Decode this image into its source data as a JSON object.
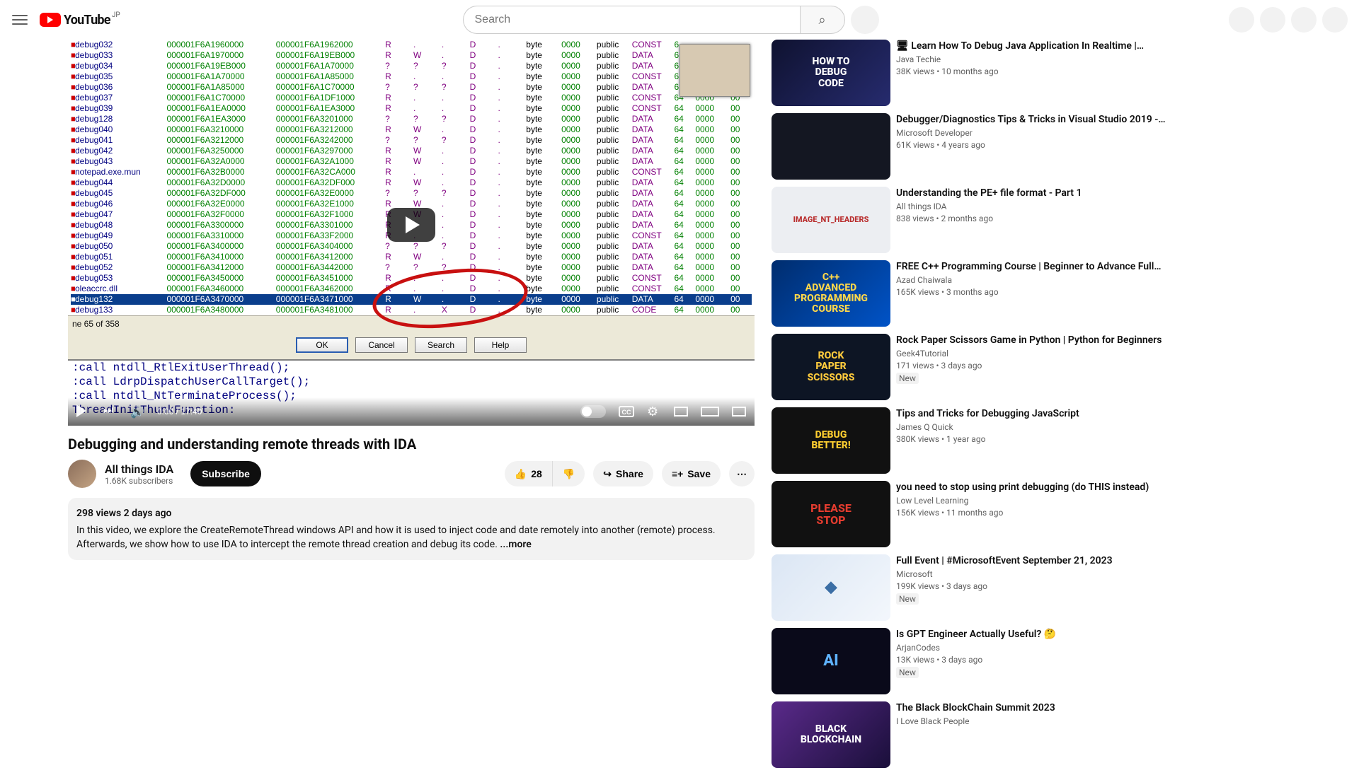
{
  "header": {
    "logo_text": "YouTube",
    "country_code": "JP",
    "search_placeholder": "Search"
  },
  "video": {
    "title": "Debugging and understanding remote threads with IDA",
    "channel_name": "All things IDA",
    "subscriber_count": "1.68K subscribers",
    "subscribe_label": "Subscribe",
    "like_count": "28",
    "share_label": "Share",
    "save_label": "Save",
    "desc_meta": "298 views  2 days ago",
    "desc_line1": "In this video, we explore the CreateRemoteThread windows API and how it is used to inject code and date remotely into another (remote) process.",
    "desc_line2": "Afterwards, we show how to use IDA to intercept the remote thread creation and debug its code. ",
    "desc_more": "...more"
  },
  "controls": {
    "time": "0:00 / 17:40",
    "cc": "CC"
  },
  "ida": {
    "line_info": "ne 65 of 358",
    "ok": "OK",
    "cancel": "Cancel",
    "search": "Search",
    "help": "Help",
    "code_lines": [
      ":call ntdll_RtlExitUserThread();",
      ":call LdrpDispatchUserCallTarget();",
      ":call ntdll_NtTerminateProcess();",
      "ThreadInitThunkFunction:"
    ],
    "rows": [
      {
        "n": "debug032",
        "s": "000001F6A1960000",
        "e": "000001F6A1962000",
        "r": "R",
        "w": ".",
        "x": ".",
        "d": "D",
        "l": ".",
        "b": "byte",
        "z": "0000",
        "p": "public",
        "t": "CONST",
        "a": "6"
      },
      {
        "n": "debug033",
        "s": "000001F6A1970000",
        "e": "000001F6A19EB000",
        "r": "R",
        "w": "W",
        "x": ".",
        "d": "D",
        "l": ".",
        "b": "byte",
        "z": "0000",
        "p": "public",
        "t": "DATA",
        "a": "6"
      },
      {
        "n": "debug034",
        "s": "000001F6A19EB000",
        "e": "000001F6A1A70000",
        "r": "?",
        "w": "?",
        "x": "?",
        "d": "D",
        "l": ".",
        "b": "byte",
        "z": "0000",
        "p": "public",
        "t": "DATA",
        "a": "6"
      },
      {
        "n": "debug035",
        "s": "000001F6A1A70000",
        "e": "000001F6A1A85000",
        "r": "R",
        "w": ".",
        "x": ".",
        "d": "D",
        "l": ".",
        "b": "byte",
        "z": "0000",
        "p": "public",
        "t": "CONST",
        "a": "6"
      },
      {
        "n": "debug036",
        "s": "000001F6A1A85000",
        "e": "000001F6A1C70000",
        "r": "?",
        "w": "?",
        "x": "?",
        "d": "D",
        "l": ".",
        "b": "byte",
        "z": "0000",
        "p": "public",
        "t": "DATA",
        "a": "6"
      },
      {
        "n": "debug037",
        "s": "000001F6A1C70000",
        "e": "000001F6A1DF1000",
        "r": "R",
        "w": ".",
        "x": ".",
        "d": "D",
        "l": ".",
        "b": "byte",
        "z": "0000",
        "p": "public",
        "t": "CONST",
        "a": "64",
        "o": "0000",
        "oo": "00"
      },
      {
        "n": "debug039",
        "s": "000001F6A1EA0000",
        "e": "000001F6A1EA3000",
        "r": "R",
        "w": ".",
        "x": ".",
        "d": "D",
        "l": ".",
        "b": "byte",
        "z": "0000",
        "p": "public",
        "t": "CONST",
        "a": "64",
        "o": "0000",
        "oo": "00"
      },
      {
        "n": "debug128",
        "s": "000001F6A1EA3000",
        "e": "000001F6A3201000",
        "r": "?",
        "w": "?",
        "x": "?",
        "d": "D",
        "l": ".",
        "b": "byte",
        "z": "0000",
        "p": "public",
        "t": "DATA",
        "a": "64",
        "o": "0000",
        "oo": "00"
      },
      {
        "n": "debug040",
        "s": "000001F6A3210000",
        "e": "000001F6A3212000",
        "r": "R",
        "w": "W",
        "x": ".",
        "d": "D",
        "l": ".",
        "b": "byte",
        "z": "0000",
        "p": "public",
        "t": "DATA",
        "a": "64",
        "o": "0000",
        "oo": "00"
      },
      {
        "n": "debug041",
        "s": "000001F6A3212000",
        "e": "000001F6A3242000",
        "r": "?",
        "w": "?",
        "x": "?",
        "d": "D",
        "l": ".",
        "b": "byte",
        "z": "0000",
        "p": "public",
        "t": "DATA",
        "a": "64",
        "o": "0000",
        "oo": "00"
      },
      {
        "n": "debug042",
        "s": "000001F6A3250000",
        "e": "000001F6A3297000",
        "r": "R",
        "w": "W",
        "x": ".",
        "d": "D",
        "l": ".",
        "b": "byte",
        "z": "0000",
        "p": "public",
        "t": "DATA",
        "a": "64",
        "o": "0000",
        "oo": "00"
      },
      {
        "n": "debug043",
        "s": "000001F6A32A0000",
        "e": "000001F6A32A1000",
        "r": "R",
        "w": "W",
        "x": ".",
        "d": "D",
        "l": ".",
        "b": "byte",
        "z": "0000",
        "p": "public",
        "t": "DATA",
        "a": "64",
        "o": "0000",
        "oo": "00"
      },
      {
        "n": "notepad.exe.mun",
        "s": "000001F6A32B0000",
        "e": "000001F6A32CA000",
        "r": "R",
        "w": ".",
        "x": ".",
        "d": "D",
        "l": ".",
        "b": "byte",
        "z": "0000",
        "p": "public",
        "t": "CONST",
        "a": "64",
        "o": "0000",
        "oo": "00"
      },
      {
        "n": "debug044",
        "s": "000001F6A32D0000",
        "e": "000001F6A32DF000",
        "r": "R",
        "w": "W",
        "x": ".",
        "d": "D",
        "l": ".",
        "b": "byte",
        "z": "0000",
        "p": "public",
        "t": "DATA",
        "a": "64",
        "o": "0000",
        "oo": "00"
      },
      {
        "n": "debug045",
        "s": "000001F6A32DF000",
        "e": "000001F6A32E0000",
        "r": "?",
        "w": "?",
        "x": "?",
        "d": "D",
        "l": ".",
        "b": "byte",
        "z": "0000",
        "p": "public",
        "t": "DATA",
        "a": "64",
        "o": "0000",
        "oo": "00"
      },
      {
        "n": "debug046",
        "s": "000001F6A32E0000",
        "e": "000001F6A32E1000",
        "r": "R",
        "w": "W",
        "x": ".",
        "d": "D",
        "l": ".",
        "b": "byte",
        "z": "0000",
        "p": "public",
        "t": "DATA",
        "a": "64",
        "o": "0000",
        "oo": "00"
      },
      {
        "n": "debug047",
        "s": "000001F6A32F0000",
        "e": "000001F6A32F1000",
        "r": "R",
        "w": "W",
        "x": ".",
        "d": "D",
        "l": ".",
        "b": "byte",
        "z": "0000",
        "p": "public",
        "t": "DATA",
        "a": "64",
        "o": "0000",
        "oo": "00"
      },
      {
        "n": "debug048",
        "s": "000001F6A3300000",
        "e": "000001F6A3301000",
        "r": "R",
        "w": ".",
        "x": ".",
        "d": "D",
        "l": ".",
        "b": "byte",
        "z": "0000",
        "p": "public",
        "t": "DATA",
        "a": "64",
        "o": "0000",
        "oo": "00"
      },
      {
        "n": "debug049",
        "s": "000001F6A3310000",
        "e": "000001F6A33F2000",
        "r": "R",
        "w": ".",
        "x": ".",
        "d": "D",
        "l": ".",
        "b": "byte",
        "z": "0000",
        "p": "public",
        "t": "CONST",
        "a": "64",
        "o": "0000",
        "oo": "00"
      },
      {
        "n": "debug050",
        "s": "000001F6A3400000",
        "e": "000001F6A3404000",
        "r": "?",
        "w": "?",
        "x": "?",
        "d": "D",
        "l": ".",
        "b": "byte",
        "z": "0000",
        "p": "public",
        "t": "DATA",
        "a": "64",
        "o": "0000",
        "oo": "00"
      },
      {
        "n": "debug051",
        "s": "000001F6A3410000",
        "e": "000001F6A3412000",
        "r": "R",
        "w": "W",
        "x": ".",
        "d": "D",
        "l": ".",
        "b": "byte",
        "z": "0000",
        "p": "public",
        "t": "DATA",
        "a": "64",
        "o": "0000",
        "oo": "00"
      },
      {
        "n": "debug052",
        "s": "000001F6A3412000",
        "e": "000001F6A3442000",
        "r": "?",
        "w": "?",
        "x": "?",
        "d": "D",
        "l": ".",
        "b": "byte",
        "z": "0000",
        "p": "public",
        "t": "DATA",
        "a": "64",
        "o": "0000",
        "oo": "00"
      },
      {
        "n": "debug053",
        "s": "000001F6A3450000",
        "e": "000001F6A3451000",
        "r": "R",
        "w": ".",
        "x": ".",
        "d": "D",
        "l": ".",
        "b": "byte",
        "z": "0000",
        "p": "public",
        "t": "CONST",
        "a": "64",
        "o": "0000",
        "oo": "00"
      },
      {
        "n": "oleaccrc.dll",
        "s": "000001F6A3460000",
        "e": "000001F6A3462000",
        "r": "R",
        "w": ".",
        "x": ".",
        "d": "D",
        "l": ".",
        "b": "byte",
        "z": "0000",
        "p": "public",
        "t": "CONST",
        "a": "64",
        "o": "0000",
        "oo": "00"
      },
      {
        "n": "debug132",
        "s": "000001F6A3470000",
        "e": "000001F6A3471000",
        "r": "R",
        "w": "W",
        "x": ".",
        "d": "D",
        "l": ".",
        "b": "byte",
        "z": "0000",
        "p": "public",
        "t": "DATA",
        "a": "64",
        "o": "0000",
        "oo": "00",
        "sel": true
      },
      {
        "n": "debug133",
        "s": "000001F6A3480000",
        "e": "000001F6A3481000",
        "r": "R",
        "w": ".",
        "x": "X",
        "d": "D",
        "l": ".",
        "b": "byte",
        "z": "0000",
        "p": "public",
        "t": "CODE",
        "a": "64",
        "o": "0000",
        "oo": "00"
      }
    ]
  },
  "reco": [
    {
      "title": "🖥 Learn How To Debug Java Application In Realtime |…",
      "ch": "Java Techie",
      "meta": "38K views  •  10 months ago",
      "thumb": "HOW TO\nDEBUG\nCODE"
    },
    {
      "title": "Debugger/Diagnostics Tips & Tricks in Visual Studio 2019 -…",
      "ch": "Microsoft Developer",
      "meta": "61K views  •  4 years ago",
      "thumb": ""
    },
    {
      "title": "Understanding the PE+ file format - Part 1",
      "ch": "All things IDA",
      "meta": "838 views  •  2 months ago",
      "thumb": "IMAGE_NT_HEADERS"
    },
    {
      "title": "FREE C++ Programming Course | Beginner to Advance Full…",
      "ch": "Azad Chaiwala",
      "meta": "165K views  •  3 months ago",
      "thumb": "C++\nADVANCED\nPROGRAMMING\nCOURSE"
    },
    {
      "title": "Rock Paper Scissors Game in Python | Python for Beginners",
      "ch": "Geek4Tutorial",
      "meta": "171 views  •  3 days ago",
      "thumb": "ROCK\nPAPER\nSCISSORS",
      "new": true
    },
    {
      "title": "Tips and Tricks for Debugging JavaScript",
      "ch": "James Q Quick",
      "meta": "380K views  •  1 year ago",
      "thumb": "DEBUG\nBETTER!"
    },
    {
      "title": "you need to stop using print debugging (do THIS instead)",
      "ch": "Low Level Learning",
      "meta": "156K views  •  11 months ago",
      "thumb": "PLEASE\nSTOP"
    },
    {
      "title": "Full Event | #MicrosoftEvent September 21, 2023",
      "ch": "Microsoft",
      "meta": "199K views  •  3 days ago",
      "thumb": "◆",
      "new": true
    },
    {
      "title": "Is GPT Engineer Actually Useful? 🤔",
      "ch": "ArjanCodes",
      "meta": "13K views  •  3 days ago",
      "thumb": "AI",
      "new": true
    },
    {
      "title": "The Black BlockChain Summit 2023",
      "ch": "I Love Black People",
      "meta": "",
      "thumb": "BLACK\nBLOCKCHAIN"
    }
  ]
}
